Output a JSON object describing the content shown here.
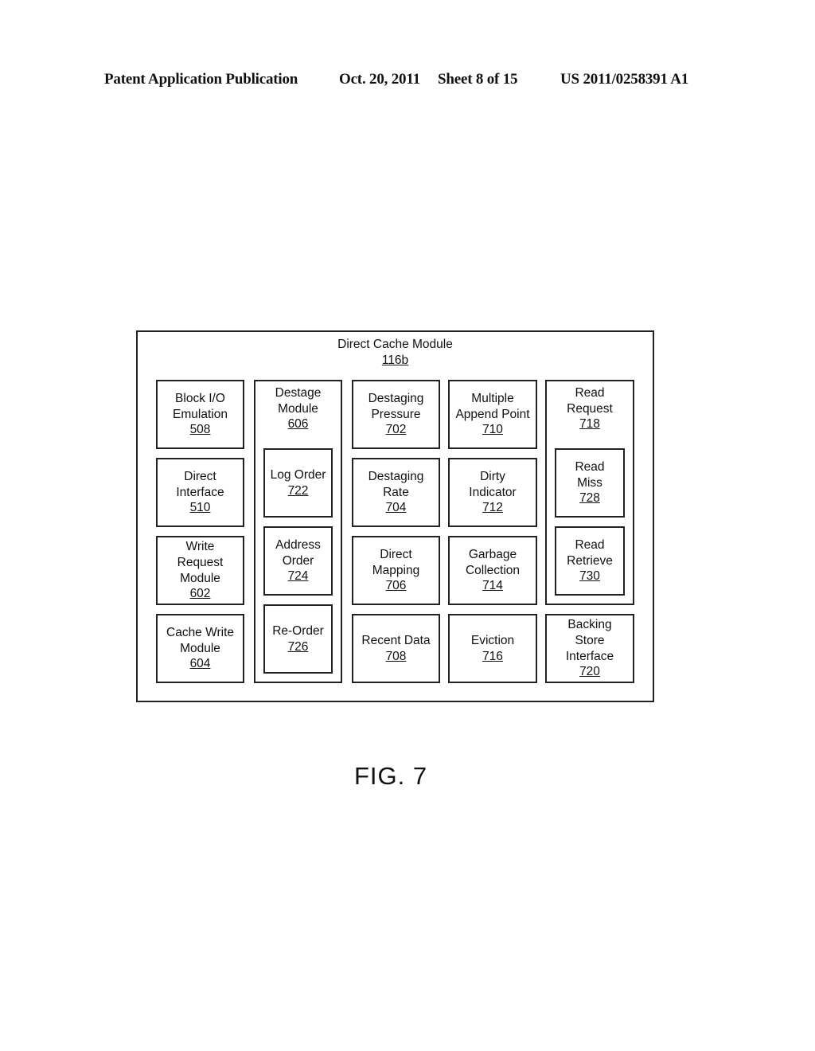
{
  "header": {
    "publication": "Patent Application Publication",
    "date": "Oct. 20, 2011",
    "sheet": "Sheet 8 of 15",
    "number": "US 2011/0258391 A1"
  },
  "diagram": {
    "outer": {
      "label": "Direct Cache Module",
      "ref": "116b"
    },
    "blocks": {
      "block_io": {
        "label": "Block I/O\nEmulation",
        "ref": "508"
      },
      "direct_iface": {
        "label": "Direct\nInterface",
        "ref": "510"
      },
      "write_request": {
        "label": "Write\nRequest\nModule",
        "ref": "602"
      },
      "cache_write": {
        "label": "Cache Write\nModule",
        "ref": "604"
      },
      "destage": {
        "label": "Destage\nModule",
        "ref": "606"
      },
      "log_order": {
        "label": "Log Order",
        "ref": "722"
      },
      "address_order": {
        "label": "Address\nOrder",
        "ref": "724"
      },
      "re_order": {
        "label": "Re-Order",
        "ref": "726"
      },
      "destaging_pressure": {
        "label": "Destaging\nPressure",
        "ref": "702"
      },
      "destaging_rate": {
        "label": "Destaging\nRate",
        "ref": "704"
      },
      "direct_mapping": {
        "label": "Direct\nMapping",
        "ref": "706"
      },
      "recent_data": {
        "label": "Recent Data",
        "ref": "708"
      },
      "multiple_append": {
        "label": "Multiple\nAppend Point",
        "ref": "710"
      },
      "dirty_indicator": {
        "label": "Dirty\nIndicator",
        "ref": "712"
      },
      "garbage_collection": {
        "label": "Garbage\nCollection",
        "ref": "714"
      },
      "eviction": {
        "label": "Eviction",
        "ref": "716"
      },
      "read_request": {
        "label": "Read\nRequest",
        "ref": "718"
      },
      "read_miss": {
        "label": "Read\nMiss",
        "ref": "728"
      },
      "read_retrieve": {
        "label": "Read\nRetrieve",
        "ref": "730"
      },
      "backing_store": {
        "label": "Backing\nStore\nInterface",
        "ref": "720"
      }
    }
  },
  "figure_label": "FIG. 7"
}
